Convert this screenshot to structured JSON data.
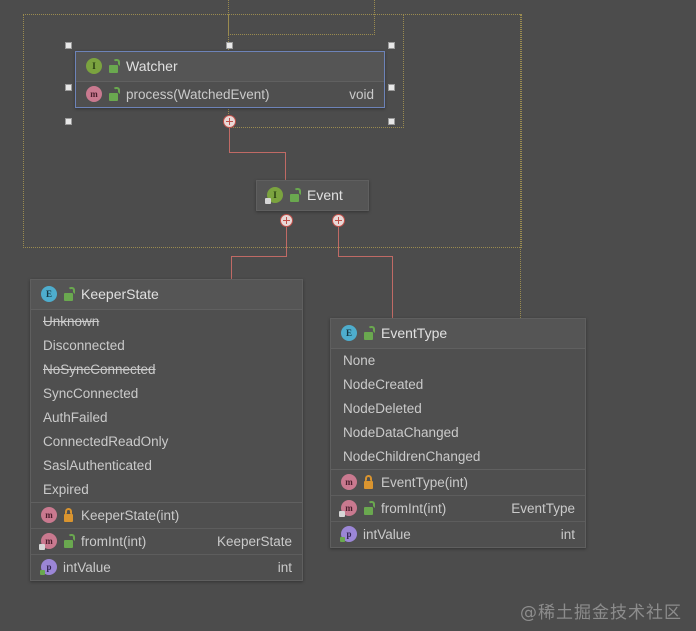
{
  "canvas": {
    "background": "#4c4c4c",
    "connector_color": "#c06a65",
    "selection_color": "#6d83b8",
    "guide_color": "#9a8b4f"
  },
  "watermark": {
    "text": "@稀土掘金技术社区"
  },
  "nodes": {
    "watcher": {
      "name": "Watcher",
      "icon": "interface-icon",
      "visibility_icon": "public-unlock-icon",
      "selected": true,
      "members": [
        {
          "name": "process(WatchedEvent)",
          "return_type": "void",
          "icon": "method-icon",
          "visibility_icon": "public-unlock-icon"
        }
      ]
    },
    "event": {
      "name": "Event",
      "icon": "interface-icon",
      "visibility_icon": "public-unlock-icon"
    },
    "keeper_state": {
      "name": "KeeperState",
      "icon": "enum-icon",
      "visibility_icon": "public-unlock-icon",
      "constants": [
        {
          "name": "Unknown",
          "deprecated": true
        },
        {
          "name": "Disconnected",
          "deprecated": false
        },
        {
          "name": "NoSyncConnected",
          "deprecated": true
        },
        {
          "name": "SyncConnected",
          "deprecated": false
        },
        {
          "name": "AuthFailed",
          "deprecated": false
        },
        {
          "name": "ConnectedReadOnly",
          "deprecated": false
        },
        {
          "name": "SaslAuthenticated",
          "deprecated": false
        },
        {
          "name": "Expired",
          "deprecated": false
        }
      ],
      "members": [
        {
          "name": "KeeperState(int)",
          "return_type": "",
          "icon": "method-icon",
          "visibility_icon": "private-lock-icon"
        },
        {
          "name": "fromInt(int)",
          "return_type": "KeeperState",
          "icon": "method-icon",
          "visibility_icon": "public-unlock-static-icon"
        },
        {
          "name": "intValue",
          "return_type": "int",
          "icon": "field-icon",
          "visibility_icon": ""
        }
      ]
    },
    "event_type": {
      "name": "EventType",
      "icon": "enum-icon",
      "visibility_icon": "public-unlock-icon",
      "constants": [
        {
          "name": "None",
          "deprecated": false
        },
        {
          "name": "NodeCreated",
          "deprecated": false
        },
        {
          "name": "NodeDeleted",
          "deprecated": false
        },
        {
          "name": "NodeDataChanged",
          "deprecated": false
        },
        {
          "name": "NodeChildrenChanged",
          "deprecated": false
        }
      ],
      "members": [
        {
          "name": "EventType(int)",
          "return_type": "",
          "icon": "method-icon",
          "visibility_icon": "private-lock-icon"
        },
        {
          "name": "fromInt(int)",
          "return_type": "EventType",
          "icon": "method-icon",
          "visibility_icon": "public-unlock-static-icon"
        },
        {
          "name": "intValue",
          "return_type": "int",
          "icon": "field-icon",
          "visibility_icon": ""
        }
      ]
    }
  },
  "icon_glyphs": {
    "interface-icon": "I",
    "enum-icon": "E",
    "method-icon": "m",
    "field-icon": "p"
  }
}
